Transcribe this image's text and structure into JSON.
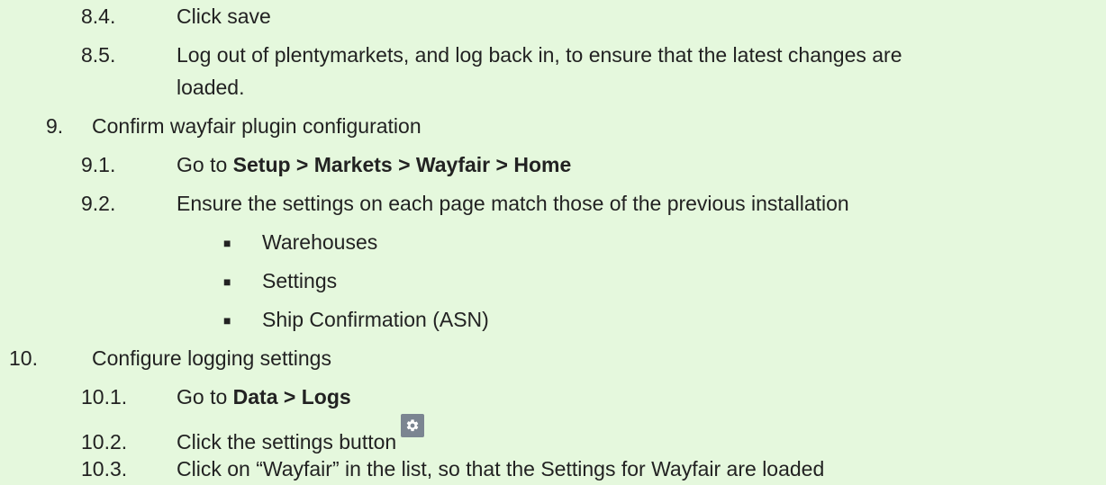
{
  "doc": {
    "items": [
      {
        "num": "8.4.",
        "text": "Click save"
      },
      {
        "num": "8.5.",
        "text": "Log out of plentymarkets, and log back in, to ensure that the latest changes are",
        "cont": "loaded."
      },
      {
        "num": "9.",
        "text": "Confirm wayfair plugin configuration"
      },
      {
        "num": "9.1.",
        "prefix": "Go to ",
        "bold": "Setup > Markets > Wayfair > Home"
      },
      {
        "num": "9.2.",
        "text": "Ensure the settings on each page match those of the previous installation"
      },
      {
        "bullet": "■",
        "text": "Warehouses"
      },
      {
        "bullet": "■",
        "text": "Settings"
      },
      {
        "bullet": "■",
        "text": "Ship Confirmation (ASN)"
      },
      {
        "num": "10.",
        "text": "Configure logging settings"
      },
      {
        "num": "10.1.",
        "prefix": "Go to ",
        "bold": "Data > Logs"
      },
      {
        "num": "10.2.",
        "text": "Click the settings button",
        "icon": "gear-icon"
      },
      {
        "num": "10.3.",
        "text": "Click on “Wayfair” in the list, so that the Settings for Wayfair are loaded"
      }
    ]
  }
}
